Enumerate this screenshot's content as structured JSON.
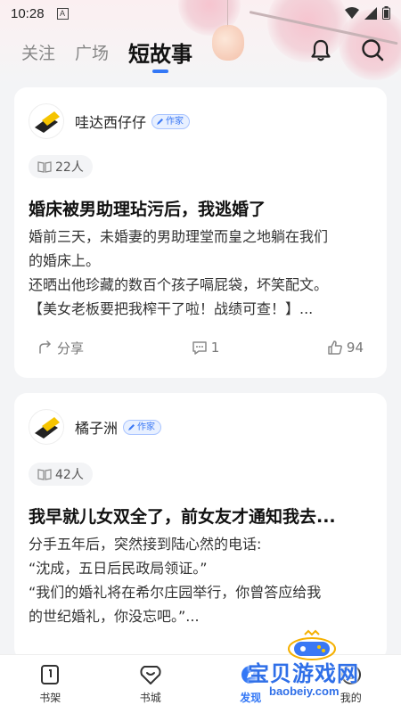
{
  "status_bar": {
    "time": "10:28",
    "notification_letter": "A"
  },
  "header": {
    "tabs": [
      {
        "label": "关注",
        "active": false
      },
      {
        "label": "广场",
        "active": false
      },
      {
        "label": "短故事",
        "active": true
      }
    ],
    "icons": [
      "bell-icon",
      "search-icon"
    ]
  },
  "accent_color": "#3478f6",
  "stories": [
    {
      "author": "哇达西仔仔",
      "badge": "作家",
      "reads": "22人",
      "title": "婚床被男助理玷污后，我逃婚了",
      "lines": [
        "婚前三天，未婚妻的男助理堂而皇之地躺在我们",
        "的婚床上。",
        "还晒出他珍藏的数百个孩子嗝屁袋，坏笑配文。",
        "【美女老板要把我榨干了啦！战绩可查！】..."
      ],
      "share_label": "分享",
      "comments": "1",
      "likes": "94"
    },
    {
      "author": "橘子洲",
      "badge": "作家",
      "reads": "42人",
      "title": "我早就儿女双全了，前女友才通知我去...",
      "lines": [
        "分手五年后，突然接到陆心然的电话:",
        "“沈成，五日后民政局领证。”",
        "“我们的婚礼将在希尔庄园举行，你曾答应给我",
        "的世纪婚礼，你没忘吧。”..."
      ]
    }
  ],
  "bottom_nav": [
    {
      "label": "书架",
      "icon": "bookshelf-icon",
      "active": false
    },
    {
      "label": "书城",
      "icon": "bookstore-icon",
      "active": false
    },
    {
      "label": "发现",
      "icon": "discover-icon",
      "active": true
    },
    {
      "label": "我的",
      "icon": "profile-icon",
      "active": false
    }
  ],
  "watermark": {
    "text": "宝贝游戏网",
    "url": "baobeiy.com"
  }
}
